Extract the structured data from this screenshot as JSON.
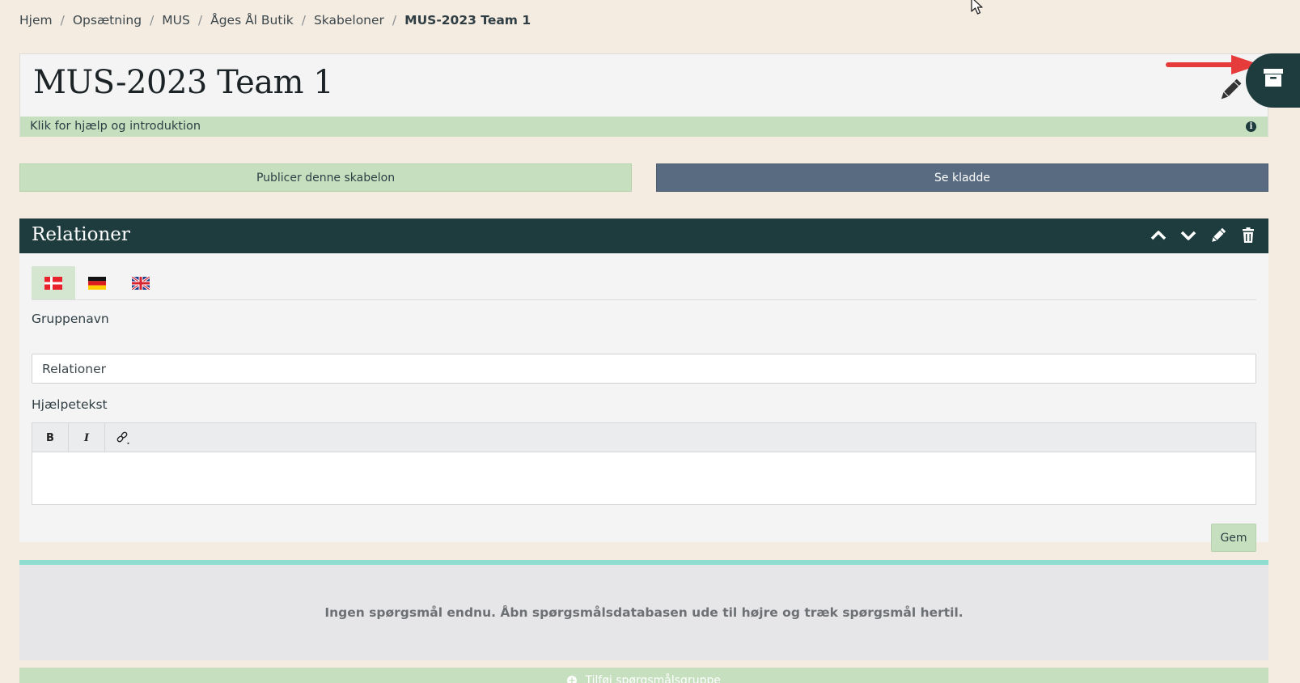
{
  "breadcrumb": {
    "items": [
      "Hjem",
      "Opsætning",
      "MUS",
      "Åges Ål Butik",
      "Skabeloner"
    ],
    "current": "MUS-2023 Team 1",
    "separator": "/"
  },
  "page": {
    "title": "MUS-2023 Team 1",
    "help_text": "Klik for hjælp og introduktion",
    "info_icon": "i"
  },
  "actions": {
    "publish_label": "Publicer denne skabelon",
    "draft_label": "Se kladde"
  },
  "group": {
    "title": "Relationer",
    "languages": [
      "da",
      "de",
      "en"
    ],
    "active_language": "da",
    "name_label": "Gruppenavn",
    "name_value": "Relationer",
    "help_label": "Hjælpetekst",
    "toolbar": {
      "bold": "B",
      "italic": "I"
    },
    "save_label": "Gem",
    "empty_message": "Ingen spørgsmål endnu. Åbn spørgsmålsdatabasen ude til højre og træk spørgsmål hertil."
  },
  "footer": {
    "add_group_label": "Tilføj spørgsmålsgruppe"
  },
  "colors": {
    "background": "#f5ece1",
    "dark_teal": "#1e3c3e",
    "soft_green": "#c5dfbf",
    "slate_button": "#596b80",
    "accent_line": "#8fdcd1",
    "arrow_red": "#e53b3b"
  },
  "icons": {
    "title_edit": "pencil-icon",
    "archive_tab": "archive-box-icon",
    "header": [
      "chevron-up-icon",
      "chevron-down-icon",
      "pencil-icon",
      "trash-icon"
    ],
    "editor": [
      "bold-icon",
      "italic-icon",
      "link-icon"
    ]
  }
}
